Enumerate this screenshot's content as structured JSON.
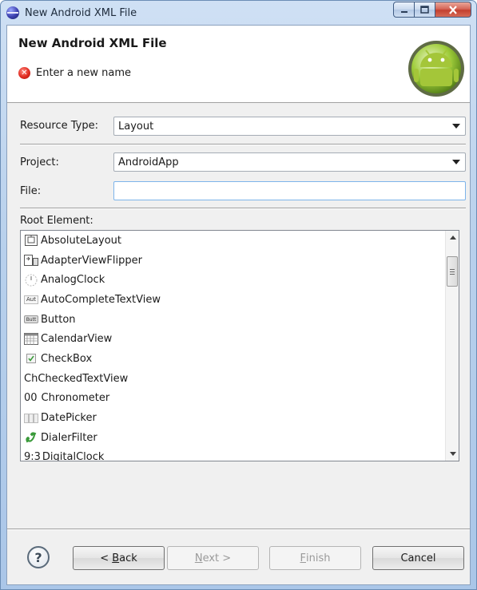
{
  "window": {
    "title": "New Android XML File"
  },
  "banner": {
    "title": "New Android XML File",
    "message": "Enter a new name"
  },
  "form": {
    "resource_type_label": "Resource Type:",
    "resource_type_value": "Layout",
    "project_label": "Project:",
    "project_value": "AndroidApp",
    "file_label": "File:",
    "file_value": "",
    "root_element_label": "Root Element:"
  },
  "root_elements": [
    {
      "label": "AbsoluteLayout",
      "icon": "absolute-layout-icon"
    },
    {
      "label": "AdapterViewFlipper",
      "icon": "adapter-view-flipper-icon"
    },
    {
      "label": "AnalogClock",
      "icon": "analog-clock-icon"
    },
    {
      "label": "AutoCompleteTextView",
      "icon": "autocomplete-icon",
      "glyph": "Aut"
    },
    {
      "label": "Button",
      "icon": "button-icon",
      "glyph": "Butt"
    },
    {
      "label": "CalendarView",
      "icon": "calendar-icon"
    },
    {
      "label": "CheckBox",
      "icon": "checkbox-icon"
    },
    {
      "label": "CheckedTextView",
      "icon": "checked-text-icon",
      "glyph": "Ch"
    },
    {
      "label": "Chronometer",
      "icon": "chronometer-icon",
      "glyph": "00"
    },
    {
      "label": "DatePicker",
      "icon": "date-picker-icon"
    },
    {
      "label": "DialerFilter",
      "icon": "phone-icon"
    },
    {
      "label": "DigitalClock",
      "icon": "digital-clock-icon",
      "glyph": "9:3"
    }
  ],
  "buttons": {
    "help": "?",
    "back_pre": "< ",
    "back_key": "B",
    "back_post": "ack",
    "next_key": "N",
    "next_post": "ext >",
    "finish_key": "F",
    "finish_post": "inish",
    "cancel": "Cancel"
  },
  "colors": {
    "error": "#e02a1f",
    "android_green": "#9fcd3b",
    "input_focus": "#7eb4ea"
  }
}
